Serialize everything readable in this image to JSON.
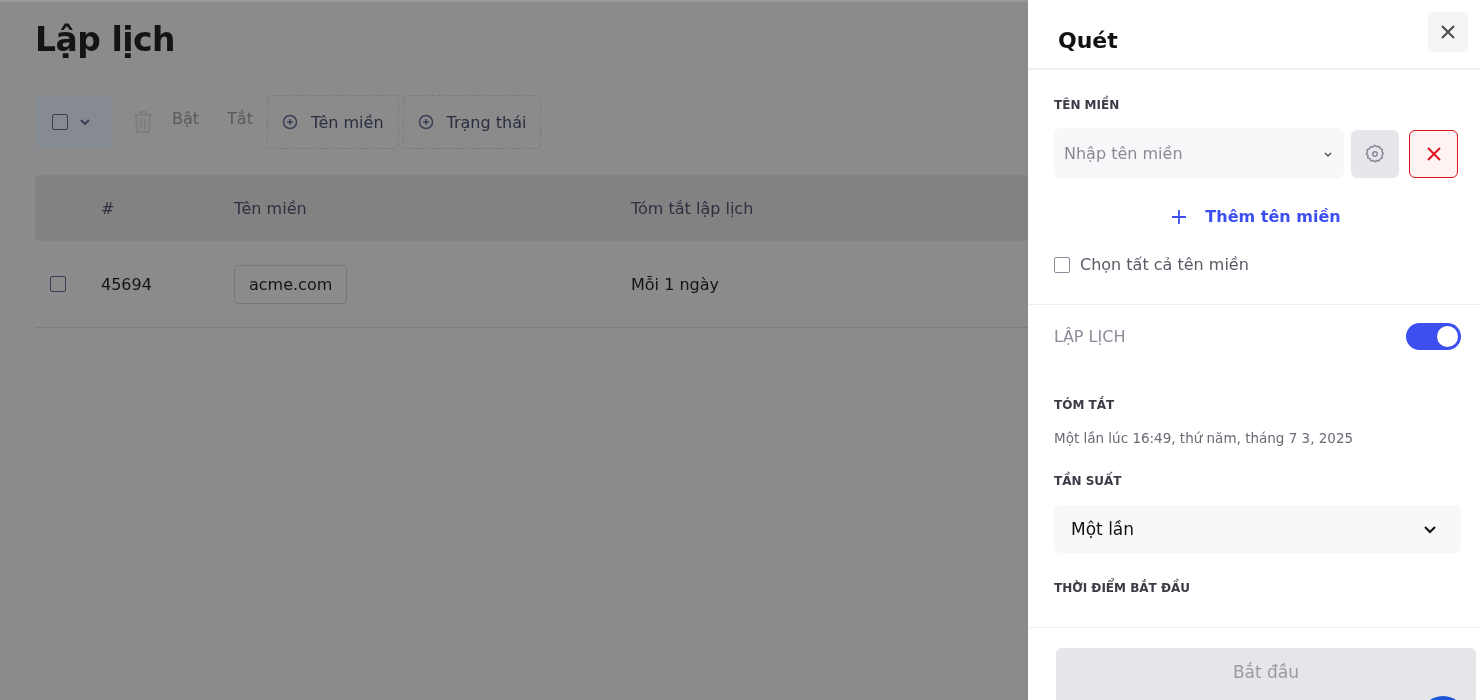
{
  "page": {
    "title": "Lập lịch",
    "toolbar": {
      "select_all": {
        "checked": false
      },
      "actions": [
        {
          "label": "Bật",
          "disabled": true
        },
        {
          "label": "Tắt",
          "disabled": true
        }
      ],
      "filters": [
        "Tên miền",
        "Trạng thái"
      ]
    },
    "table": {
      "columns": [
        "#",
        "Tên miền",
        "Tóm tắt lập lịch"
      ],
      "rows": [
        {
          "checked": false,
          "id": "45694",
          "domain": "acme.com",
          "summary": "Mỗi 1 ngày"
        }
      ]
    }
  },
  "panel": {
    "title": "Quét",
    "domain": {
      "label": "TÊN MIỀN",
      "placeholder": "Nhập tên miền",
      "add_label": "Thêm tên miền",
      "select_all": {
        "label": "Chọn tất cả tên miền",
        "checked": false
      }
    },
    "schedule": {
      "label": "LẬP LỊCH",
      "on": true
    },
    "summary": {
      "label": "TÓM TẮT",
      "text": "Một lần lúc 16:49, thứ năm, tháng 7 3, 2025"
    },
    "frequency": {
      "label": "TẦN SUẤT",
      "value": "Một lần"
    },
    "start_time": {
      "label": "THỜI ĐIỂM BẮT ĐẦU"
    },
    "submit": {
      "label": "Bắt đầu",
      "disabled": true
    }
  }
}
